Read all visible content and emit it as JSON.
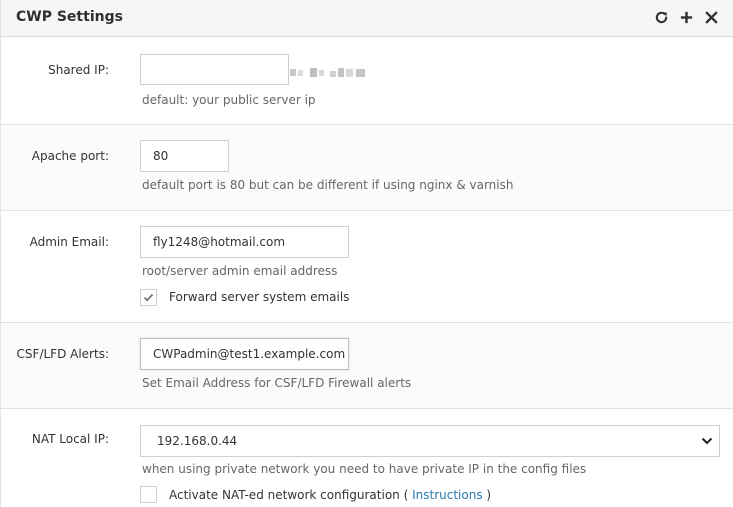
{
  "panel": {
    "title": "CWP Settings",
    "icons": [
      "refresh-icon",
      "plus-icon",
      "close-icon"
    ]
  },
  "shared_ip": {
    "label": "Shared IP:",
    "value": "",
    "help": "default: your public server ip"
  },
  "apache_port": {
    "label": "Apache port:",
    "value": "80",
    "help": "default port is 80 but can be different if using nginx & varnish"
  },
  "admin_email": {
    "label": "Admin Email:",
    "value": "fly1248@hotmail.com",
    "help": "root/server admin email address",
    "checkbox_label": "Forward server system emails",
    "checkbox_checked": true
  },
  "csf_alerts": {
    "label": "CSF/LFD Alerts:",
    "value": "CWPadmin@test1.example.com",
    "help": "Set Email Address for CSF/LFD Firewall alerts"
  },
  "nat_ip": {
    "label": "NAT Local IP:",
    "selected": "192.168.0.44",
    "help": "when using private network you need to have private IP in the config files",
    "checkbox_label_prefix": "Activate NAT-ed network configuration (",
    "checkbox_link": "Instructions",
    "checkbox_label_suffix": ")",
    "checkbox_checked": false
  },
  "colors": {
    "link": "#2a7ab0",
    "header_bg": "#f6f6f6",
    "border": "#cfcfcf"
  }
}
